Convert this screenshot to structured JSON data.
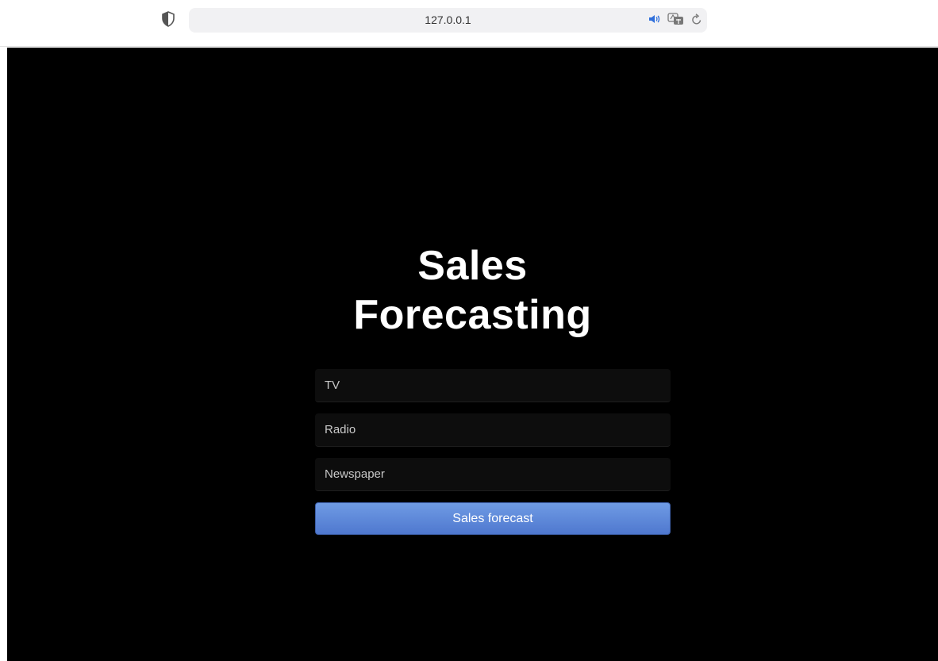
{
  "browser": {
    "url": "127.0.0.1"
  },
  "page": {
    "title_line1": "Sales",
    "title_line2": "Forecasting"
  },
  "form": {
    "tv_placeholder": "TV",
    "radio_placeholder": "Radio",
    "newspaper_placeholder": "Newspaper",
    "submit_label": "Sales forecast"
  },
  "colors": {
    "background": "#000000",
    "button_top": "#6f9be4",
    "button_bottom": "#4f78cf",
    "speaker_icon": "#2f6fdb"
  },
  "icons": {
    "shield": "shield-icon",
    "speaker": "speaker-icon",
    "translate": "translate-icon",
    "reload": "reload-icon"
  }
}
